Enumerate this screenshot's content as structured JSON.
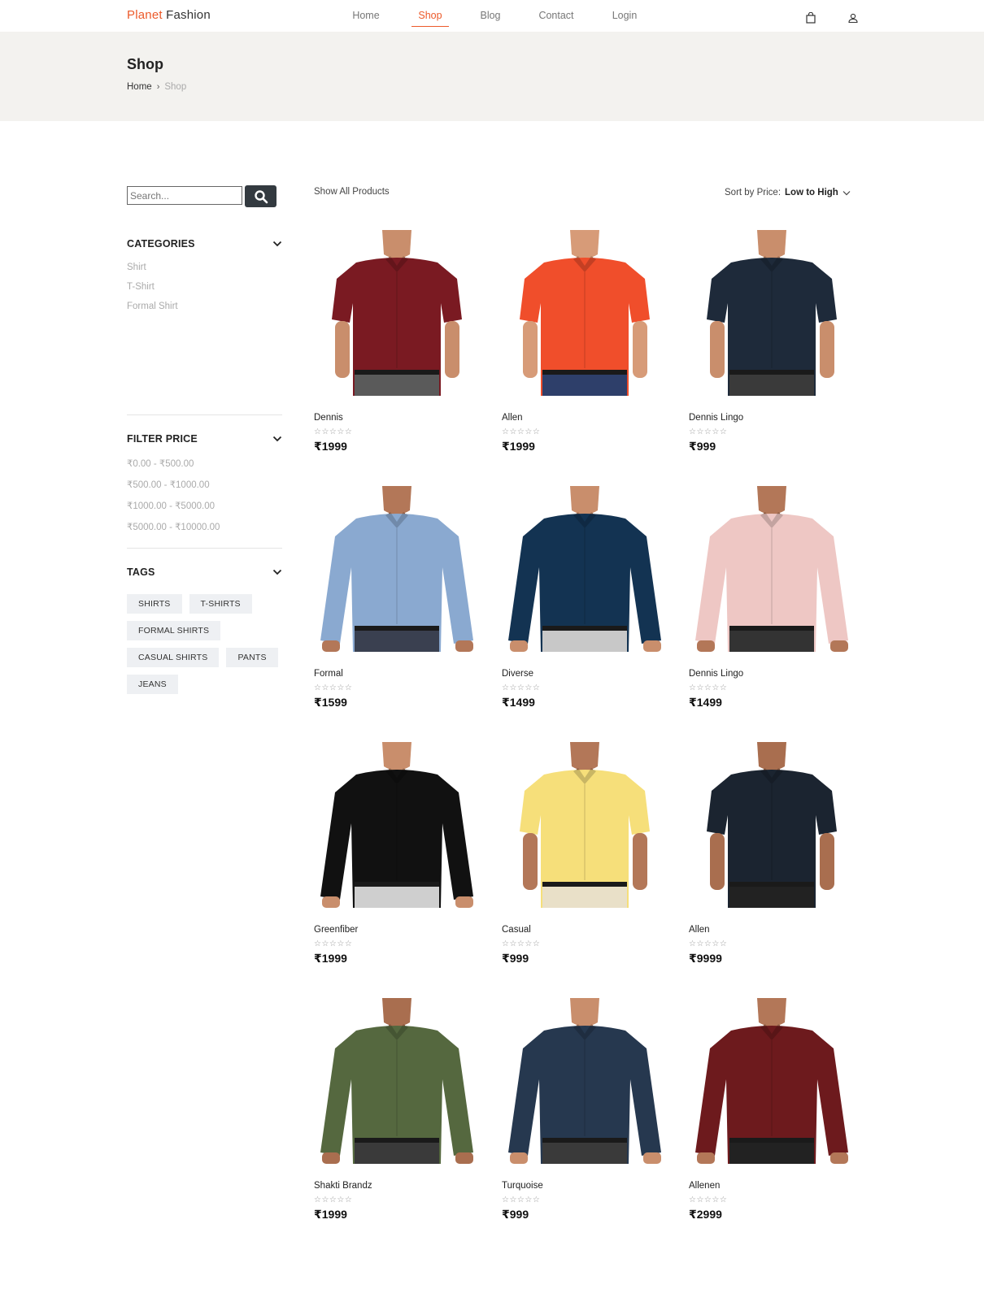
{
  "brand": {
    "part1": "Planet",
    "part2": "Fashion"
  },
  "nav": [
    {
      "label": "Home",
      "active": false
    },
    {
      "label": "Shop",
      "active": true
    },
    {
      "label": "Blog",
      "active": false
    },
    {
      "label": "Contact",
      "active": false
    },
    {
      "label": "Login",
      "active": false
    }
  ],
  "header_icons": [
    "shopping-bag-icon",
    "user-icon"
  ],
  "banner": {
    "title": "Shop",
    "crumb_home": "Home",
    "crumb_sep": "›",
    "crumb_current": "Shop"
  },
  "search": {
    "placeholder": "Search...",
    "button_icon": "search-icon"
  },
  "categories": {
    "title": "CATEGORIES",
    "items": [
      "Shirt",
      "T-Shirt",
      "Formal Shirt"
    ]
  },
  "filter_price": {
    "title": "FILTER PRICE",
    "items": [
      "₹0.00 - ₹500.00",
      "₹500.00 - ₹1000.00",
      "₹1000.00 - ₹5000.00",
      "₹5000.00 - ₹10000.00"
    ]
  },
  "tags": {
    "title": "TAGS",
    "items": [
      "SHIRTS",
      "T-SHIRTS",
      "FORMAL SHIRTS",
      "CASUAL SHIRTS",
      "PANTS",
      "JEANS"
    ]
  },
  "toolbar": {
    "show_all": "Show All Products",
    "sort_prefix": "Sort by Price:",
    "sort_value": "Low to High"
  },
  "products": [
    {
      "name": "Dennis",
      "rating": "☆☆☆☆☆",
      "price": "₹1999",
      "shirt": "#7a1a22",
      "skin": "#c98e6c",
      "pants": "#5a5a5a",
      "sleeve": "short"
    },
    {
      "name": "Allen",
      "rating": "☆☆☆☆☆",
      "price": "₹1999",
      "shirt": "#f04e2b",
      "skin": "#d79b78",
      "pants": "#2e3f6a",
      "sleeve": "short"
    },
    {
      "name": "Dennis Lingo",
      "rating": "☆☆☆☆☆",
      "price": "₹999",
      "shirt": "#1e2a3a",
      "skin": "#c98e6c",
      "pants": "#3a3a3a",
      "sleeve": "short"
    },
    {
      "name": "Formal",
      "rating": "☆☆☆☆☆",
      "price": "₹1599",
      "shirt": "#8aa9d0",
      "skin": "#b37758",
      "pants": "#3a4050",
      "sleeve": "rolled"
    },
    {
      "name": "Diverse",
      "rating": "☆☆☆☆☆",
      "price": "₹1499",
      "shirt": "#133352",
      "skin": "#c98e6c",
      "pants": "#c8c8c8",
      "sleeve": "long"
    },
    {
      "name": "Dennis Lingo",
      "rating": "☆☆☆☆☆",
      "price": "₹1499",
      "shirt": "#eec7c4",
      "skin": "#b37758",
      "pants": "#333333",
      "sleeve": "long"
    },
    {
      "name": "Greenfiber",
      "rating": "☆☆☆☆☆",
      "price": "₹1999",
      "shirt": "#111111",
      "skin": "#c98e6c",
      "pants": "#cfcfcf",
      "sleeve": "long"
    },
    {
      "name": "Casual",
      "rating": "☆☆☆☆☆",
      "price": "₹999",
      "shirt": "#f6df7a",
      "skin": "#b37758",
      "pants": "#e9e0c8",
      "sleeve": "short"
    },
    {
      "name": "Allen",
      "rating": "☆☆☆☆☆",
      "price": "₹9999",
      "shirt": "#1b2430",
      "skin": "#a96e4f",
      "pants": "#222222",
      "sleeve": "short"
    },
    {
      "name": "Shakti Brandz",
      "rating": "☆☆☆☆☆",
      "price": "₹1999",
      "shirt": "#55683f",
      "skin": "#a96e4f",
      "pants": "#3a3a3a",
      "sleeve": "rolled"
    },
    {
      "name": "Turquoise",
      "rating": "☆☆☆☆☆",
      "price": "₹999",
      "shirt": "#26384f",
      "skin": "#c98e6c",
      "pants": "#3a3a3a",
      "sleeve": "rolled"
    },
    {
      "name": "Allenen",
      "rating": "☆☆☆☆☆",
      "price": "₹2999",
      "shirt": "#6d1a1d",
      "skin": "#b37758",
      "pants": "#222222",
      "sleeve": "rolled"
    }
  ],
  "colors": {
    "accent": "#ec5a2a",
    "banner_bg": "#f3f2ef",
    "search_btn": "#333a40",
    "tag_bg": "#eef0f3"
  }
}
